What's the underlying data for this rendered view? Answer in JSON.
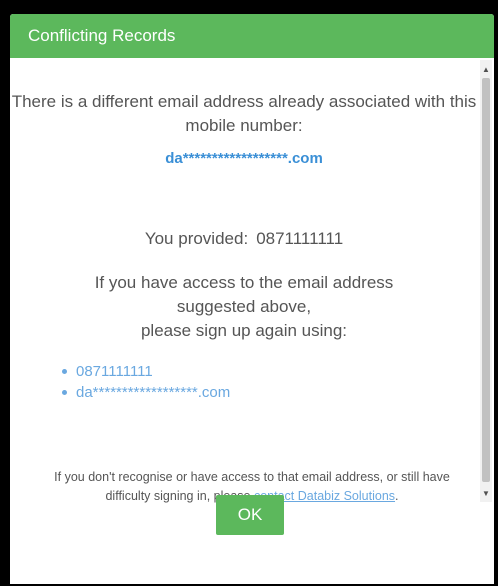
{
  "dialog": {
    "title": "Conflicting Records",
    "message_line1": "There is a different email address already associated with this mobile number:",
    "masked_email": "da******************.com",
    "provided_label": "You provided:",
    "provided_number": "0871111111",
    "instruction_line1": "If you have access to the email address",
    "instruction_line2": "suggested above,",
    "instruction_line3": "please sign up again using:",
    "list": [
      "0871111111",
      "da******************.com"
    ],
    "note_text": "If you don't recognise or have access to that email address, or still have difficulty signing in, please",
    "note_link": "contact Databiz Solutions",
    "note_end": ".",
    "ok_label": "OK"
  },
  "colors": {
    "accent": "#5cb85c",
    "link": "#6aa8e0",
    "text": "#555555"
  }
}
